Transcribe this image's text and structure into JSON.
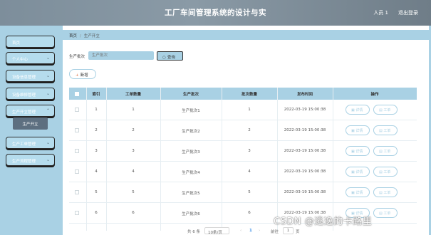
{
  "header": {
    "title": "工厂车间管理系统的设计与实",
    "user": "人员 1",
    "logout": "退出登录"
  },
  "sidebar": {
    "items": [
      {
        "label": "首页",
        "has_chevron": false
      },
      {
        "label": "个人中心",
        "has_chevron": true
      },
      {
        "label": "设备信息管理",
        "has_chevron": true
      },
      {
        "label": "设备维修管理",
        "has_chevron": true
      },
      {
        "label": "生产开立管理",
        "has_chevron": true
      },
      {
        "label": "生产工单管理",
        "has_chevron": true
      },
      {
        "label": "生产流程管理",
        "has_chevron": true
      }
    ],
    "submenu": {
      "label": "生产开立"
    }
  },
  "breadcrumb": {
    "home": "首页",
    "separator": "/",
    "current": "生产开立"
  },
  "search": {
    "label": "生产批次",
    "placeholder": "生产批次",
    "button": "查询"
  },
  "toolbar": {
    "add_label": "新增"
  },
  "table": {
    "columns": [
      "索引",
      "工单数量",
      "生产批次",
      "批次数量",
      "发布时间",
      "操作"
    ],
    "rows": [
      {
        "index": "1",
        "qty": "1",
        "batch": "生产批次1",
        "batch_qty": "1",
        "time": "2022-03-19 15:00:38"
      },
      {
        "index": "2",
        "qty": "2",
        "batch": "生产批次2",
        "batch_qty": "2",
        "time": "2022-03-19 15:00:38"
      },
      {
        "index": "3",
        "qty": "3",
        "batch": "生产批次3",
        "batch_qty": "3",
        "time": "2022-03-19 15:00:38"
      },
      {
        "index": "4",
        "qty": "4",
        "batch": "生产批次4",
        "batch_qty": "4",
        "time": "2022-03-19 15:00:38"
      },
      {
        "index": "5",
        "qty": "5",
        "batch": "生产批次5",
        "batch_qty": "5",
        "time": "2022-03-19 15:00:38"
      },
      {
        "index": "6",
        "qty": "6",
        "batch": "生产批次6",
        "batch_qty": "6",
        "time": "2022-03-19 15:00:38"
      }
    ],
    "actions": {
      "detail": "详情",
      "work": "工单"
    }
  },
  "pagination": {
    "total": "共 6 条",
    "page_size": "10条/页",
    "prev": "‹",
    "current_page": "1",
    "next": "›",
    "goto_label": "前往",
    "goto_value": "1",
    "unit": "页"
  },
  "watermark": "CSDN @逃逸的卡路里",
  "colors": {
    "accent": "#a9d1e4",
    "header": "#7d8e9b",
    "submenu": "#5d6f80"
  }
}
